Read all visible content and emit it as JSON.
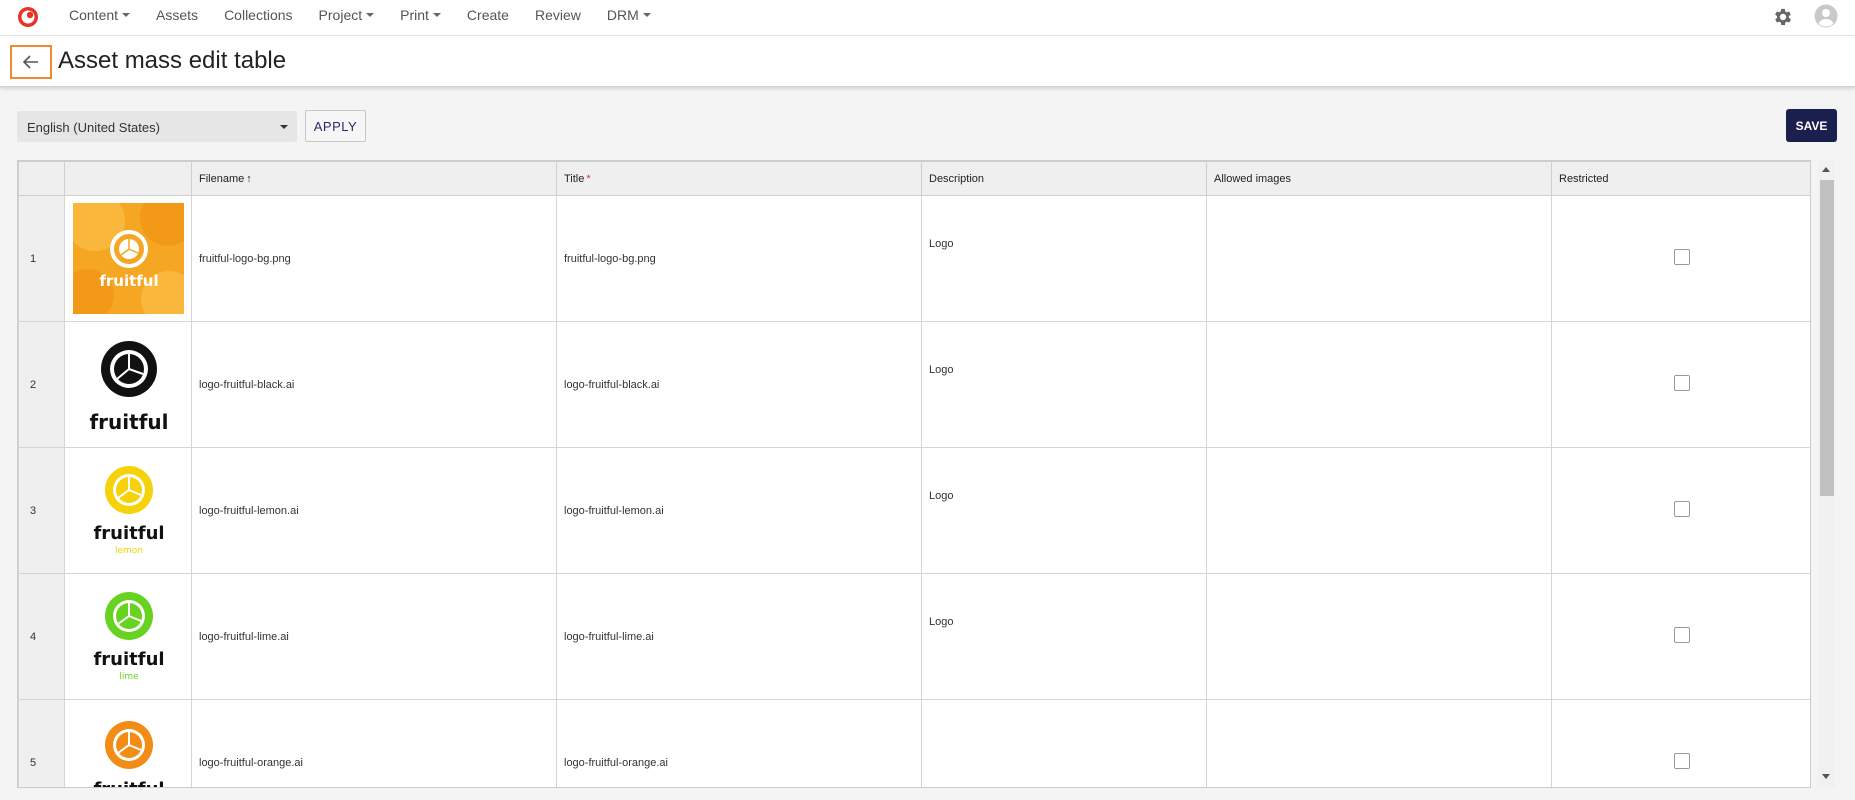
{
  "nav": {
    "items": [
      {
        "label": "Content",
        "dropdown": true
      },
      {
        "label": "Assets",
        "dropdown": false
      },
      {
        "label": "Collections",
        "dropdown": false
      },
      {
        "label": "Project",
        "dropdown": true
      },
      {
        "label": "Print",
        "dropdown": true
      },
      {
        "label": "Create",
        "dropdown": false
      },
      {
        "label": "Review",
        "dropdown": false
      },
      {
        "label": "DRM",
        "dropdown": true
      }
    ],
    "logo_color": "#e8322a"
  },
  "header": {
    "title": "Asset mass edit table",
    "back_highlight_color": "#f08a2c"
  },
  "toolbar": {
    "locale_value": "English (United States)",
    "apply_label": "APPLY",
    "save_label": "SAVE",
    "save_color": "#1b1f4d"
  },
  "table": {
    "columns": [
      {
        "label": "",
        "key": "rownum"
      },
      {
        "label": "",
        "key": "thumb"
      },
      {
        "label": "Filename",
        "key": "filename",
        "sort": "↑"
      },
      {
        "label": "Title",
        "key": "title",
        "required": "*"
      },
      {
        "label": "Description",
        "key": "description"
      },
      {
        "label": "Allowed images",
        "key": "allowed_images"
      },
      {
        "label": "Restricted",
        "key": "restricted"
      }
    ],
    "rows": [
      {
        "num": "1",
        "thumb": "fruitful-orange-photo",
        "thumb_brand": "fruitful",
        "thumb_sub": "",
        "filename": "fruitful-logo-bg.png",
        "title": "fruitful-logo-bg.png",
        "description": "Logo",
        "allowed_images": "",
        "restricted": false
      },
      {
        "num": "2",
        "thumb": "fruitful-logo-black",
        "thumb_brand": "fruitful",
        "thumb_sub": "",
        "filename": "logo-fruitful-black.ai",
        "title": "logo-fruitful-black.ai",
        "description": "Logo",
        "allowed_images": "",
        "restricted": false
      },
      {
        "num": "3",
        "thumb": "fruitful-logo-lemon",
        "thumb_brand": "fruitful",
        "thumb_sub": "lemon",
        "filename": "logo-fruitful-lemon.ai",
        "title": "logo-fruitful-lemon.ai",
        "description": "Logo",
        "allowed_images": "",
        "restricted": false
      },
      {
        "num": "4",
        "thumb": "fruitful-logo-lime",
        "thumb_brand": "fruitful",
        "thumb_sub": "lime",
        "filename": "logo-fruitful-lime.ai",
        "title": "logo-fruitful-lime.ai",
        "description": "Logo",
        "allowed_images": "",
        "restricted": false
      },
      {
        "num": "5",
        "thumb": "fruitful-logo-orange",
        "thumb_brand": "fruitful",
        "thumb_sub": "",
        "filename": "logo-fruitful-orange.ai",
        "title": "logo-fruitful-orange.ai",
        "description": "",
        "allowed_images": "",
        "restricted": false
      }
    ],
    "brand_colors": {
      "lemon": "#f5d20a",
      "lime": "#67d21f",
      "orange": "#f28c15",
      "black": "#111111",
      "photo": "#f5a623"
    }
  }
}
